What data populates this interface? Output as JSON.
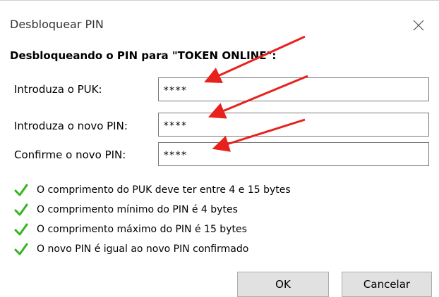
{
  "window": {
    "title": "Desbloquear PIN",
    "close_icon": "close-icon"
  },
  "heading": "Desbloqueando o PIN para \"TOKEN ONLINE\":",
  "fields": [
    {
      "label": "Introduza o PUK:",
      "value": "****"
    },
    {
      "label": "Introduza o novo PIN:",
      "value": "****"
    },
    {
      "label": "Confirme o novo PIN:",
      "value": "****"
    }
  ],
  "checks": [
    {
      "text": "O comprimento do PUK deve ter entre 4 e 15 bytes",
      "icon": "checkmark-icon"
    },
    {
      "text": "O comprimento mínimo do PIN é 4 bytes",
      "icon": "checkmark-icon"
    },
    {
      "text": "O comprimento máximo do PIN é 15 bytes",
      "icon": "checkmark-icon"
    },
    {
      "text": "O novo PIN é igual ao novo PIN confirmado",
      "icon": "checkmark-icon"
    }
  ],
  "buttons": {
    "ok": "OK",
    "cancel": "Cancelar"
  },
  "colors": {
    "check": "#34b51f",
    "arrow": "#e8211d"
  }
}
